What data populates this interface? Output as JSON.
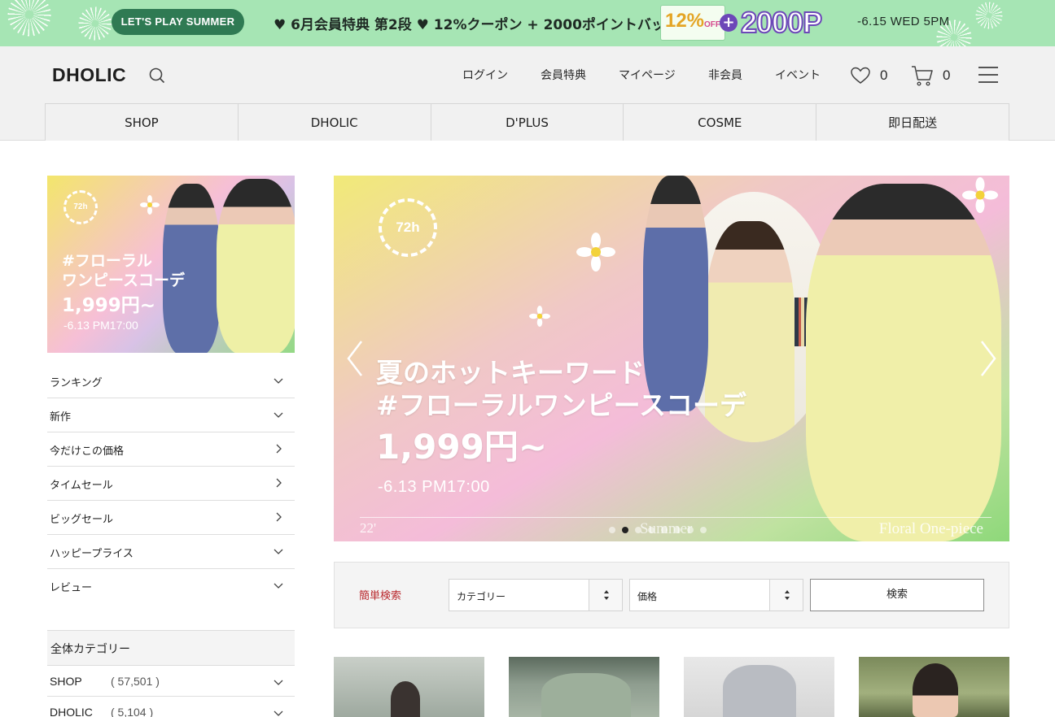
{
  "promo": {
    "pill": "LET'S PLAY SUMMER",
    "headline": "♥ 6月会員特典 第2段 ♥ 12%クーポン + 2000ポイントバック",
    "coupon_value": "12%",
    "coupon_off": "OFF",
    "plus": "+",
    "points": "2000P",
    "deadline": "-6.15 WED 5PM"
  },
  "header": {
    "logo": "DHOLIC",
    "nav": [
      "ログイン",
      "会員特典",
      "マイページ",
      "非会員",
      "イベント"
    ],
    "wishlist_count": "0",
    "cart_count": "0"
  },
  "tabs": [
    "SHOP",
    "DHOLIC",
    "D'PLUS",
    "COSME",
    "即日配送"
  ],
  "side_banner": {
    "timer": "72h",
    "line1": "#フローラル",
    "line2": "ワンピースコーデ",
    "price": "1,999円~",
    "date": "-6.13 PM17:00"
  },
  "side_menu": [
    {
      "label": "ランキング",
      "chevron": "down"
    },
    {
      "label": "新作",
      "chevron": "down"
    },
    {
      "label": "今だけこの価格",
      "chevron": "right"
    },
    {
      "label": "タイムセール",
      "chevron": "right"
    },
    {
      "label": "ビッグセール",
      "chevron": "right"
    },
    {
      "label": "ハッピープライス",
      "chevron": "down"
    },
    {
      "label": "レビュー",
      "chevron": "down"
    }
  ],
  "categories": {
    "title": "全体カテゴリー",
    "rows": [
      {
        "name": "SHOP",
        "count": "( 57,501 )"
      },
      {
        "name": "DHOLIC",
        "count": "( 5,104 )"
      }
    ]
  },
  "hero": {
    "timer": "72h",
    "line1": "夏のホットキーワード",
    "line2": "#フローラルワンピースコーデ",
    "price": "1,999円~",
    "date": "-6.13 PM17:00",
    "footer_left": "22'",
    "footer_center": "Summer",
    "footer_right": "Floral One-piece",
    "slide_count": 8,
    "active_slide": 1
  },
  "search": {
    "label": "簡単検索",
    "category_value": "カテゴリー",
    "price_value": "価格",
    "button": "検索"
  },
  "colors": {
    "promo_bg": "#a6e5b4",
    "promo_pill": "#2f7a53",
    "points_purple": "#6c47b8",
    "search_label": "#b9282d"
  }
}
